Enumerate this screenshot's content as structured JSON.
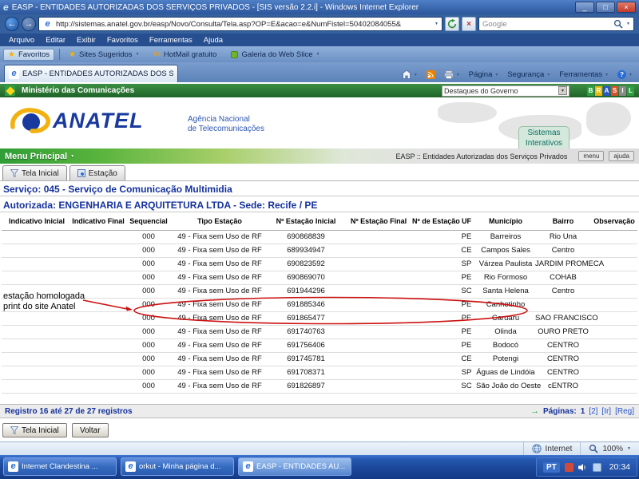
{
  "window": {
    "title": "EASP - ENTIDADES AUTORIZADAS DOS SERVIÇOS PRIVADOS - [SIS versão 2.2.i] - Windows Internet Explorer",
    "address_url": "http://sistemas.anatel.gov.br/easp/Novo/Consulta/Tela.asp?OP=E&acao=e&NumFistel=50402084055&",
    "search_value": "Google"
  },
  "menubar": {
    "items": [
      "Arquivo",
      "Editar",
      "Exibir",
      "Favoritos",
      "Ferramentas",
      "Ajuda"
    ]
  },
  "favbar": {
    "favoritos_label": "Favoritos",
    "items": [
      {
        "label": "Sites Sugeridos",
        "icon": "star-icon",
        "arrow": true
      },
      {
        "label": "HotMail gratuito",
        "icon": "mail-icon",
        "arrow": false
      },
      {
        "label": "Galeria do Web Slice",
        "icon": "webslice-icon",
        "arrow": true
      }
    ]
  },
  "tabrow": {
    "tab_title": "EASP - ENTIDADES AUTORIZADAS DOS SERVIÇOS PR...",
    "pagina": "Página",
    "seguranca": "Segurança",
    "ferramentas": "Ferramentas"
  },
  "govbar": {
    "ministry": "Ministério das Comunicações",
    "dropdown_value": "Destaques do Governo",
    "logo_text": "BRASIL"
  },
  "brand": {
    "logo_text": "ANATEL",
    "subtitle_line1": "Agência Nacional",
    "subtitle_line2": "de Telecomunicações",
    "sistemas_line1": "Sistemas",
    "sistemas_line2": "Interativos"
  },
  "menu_principal": {
    "label": "Menu Principal",
    "breadcrumb": "EASP :: Entidades Autorizadas dos Serviços Privados",
    "menu_btn": "menu",
    "ajuda_btn": "ajuda"
  },
  "page_tabs": {
    "tela_inicial": "Tela Inicial",
    "estacao": "Estação"
  },
  "section_headers": {
    "servico": "Serviço: 045 - Serviço de Comunicação Multimidia",
    "autorizada": "Autorizada: ENGENHARIA E ARQUITETURA LTDA - Sede: Recife / PE"
  },
  "table": {
    "columns": [
      "Indicativo Inicial",
      "Indicativo Final",
      "Sequencial",
      "Tipo Estação",
      "Nº Estação Inicial",
      "Nº Estação Final",
      "Nº de Estação",
      "UF",
      "Município",
      "Bairro",
      "Observação"
    ],
    "rows": [
      [
        "",
        "",
        "000",
        "49 - Fixa sem Uso de RF",
        "690868839",
        "",
        "",
        "PE",
        "Barreiros",
        "Rio Una",
        ""
      ],
      [
        "",
        "",
        "000",
        "49 - Fixa sem Uso de RF",
        "689934947",
        "",
        "",
        "CE",
        "Campos Sales",
        "Centro",
        ""
      ],
      [
        "",
        "",
        "000",
        "49 - Fixa sem Uso de RF",
        "690823592",
        "",
        "",
        "SP",
        "Várzea Paulista",
        "JARDIM PROMECA",
        ""
      ],
      [
        "",
        "",
        "000",
        "49 - Fixa sem Uso de RF",
        "690869070",
        "",
        "",
        "PE",
        "Rio Formoso",
        "COHAB",
        ""
      ],
      [
        "",
        "",
        "000",
        "49 - Fixa sem Uso de RF",
        "691944296",
        "",
        "",
        "SC",
        "Santa Helena",
        "Centro",
        ""
      ],
      [
        "",
        "",
        "000",
        "49 - Fixa sem Uso de RF",
        "691885346",
        "",
        "",
        "PE",
        "Canhotinho",
        "",
        ""
      ],
      [
        "",
        "",
        "000",
        "49 - Fixa sem Uso de RF",
        "691865477",
        "",
        "",
        "PE",
        "Caruaru",
        "SAO FRANCISCO",
        ""
      ],
      [
        "",
        "",
        "000",
        "49 - Fixa sem Uso de RF",
        "691740763",
        "",
        "",
        "PE",
        "Olinda",
        "OURO PRETO",
        ""
      ],
      [
        "",
        "",
        "000",
        "49 - Fixa sem Uso de RF",
        "691756406",
        "",
        "",
        "PE",
        "Bodocó",
        "CENTRO",
        ""
      ],
      [
        "",
        "",
        "000",
        "49 - Fixa sem Uso de RF",
        "691745781",
        "",
        "",
        "CE",
        "Potengi",
        "CENTRO",
        ""
      ],
      [
        "",
        "",
        "000",
        "49 - Fixa sem Uso de RF",
        "691708371",
        "",
        "",
        "SP",
        "Águas de Lindóia",
        "CENTRO",
        ""
      ],
      [
        "",
        "",
        "000",
        "49 - Fixa sem Uso de RF",
        "691826897",
        "",
        "",
        "SC",
        "São João do Oeste",
        "cENTRO",
        ""
      ]
    ]
  },
  "annotation": {
    "line1": "estação homologada",
    "line2": "print do site Anatel",
    "color": "#cc1111"
  },
  "pager": {
    "registro_text": "Registro 16 até 27 de 27 registros",
    "paginas_label": "Páginas:",
    "current_page": "1",
    "page2": "[2]",
    "ir": "[Ir]",
    "reg": "[Reg]"
  },
  "bottom_buttons": {
    "tela_inicial": "Tela Inicial",
    "voltar": "Voltar"
  },
  "statusbar": {
    "zone": "Internet",
    "zoom": "100%"
  },
  "taskbar": {
    "windows": [
      "Internet Clandestina ...",
      "orkut - Minha página d...",
      "EASP - ENTIDADES AU..."
    ],
    "language": "PT",
    "clock": "20:34"
  },
  "colors": {
    "anatel_blue": "#18399e",
    "anatel_yellow": "#f2b10e",
    "gov_green": "#2e7d33",
    "annotation_red": "#cc1111",
    "link_blue": "#2a55cc",
    "taskbar_blue": "#1c479a"
  }
}
